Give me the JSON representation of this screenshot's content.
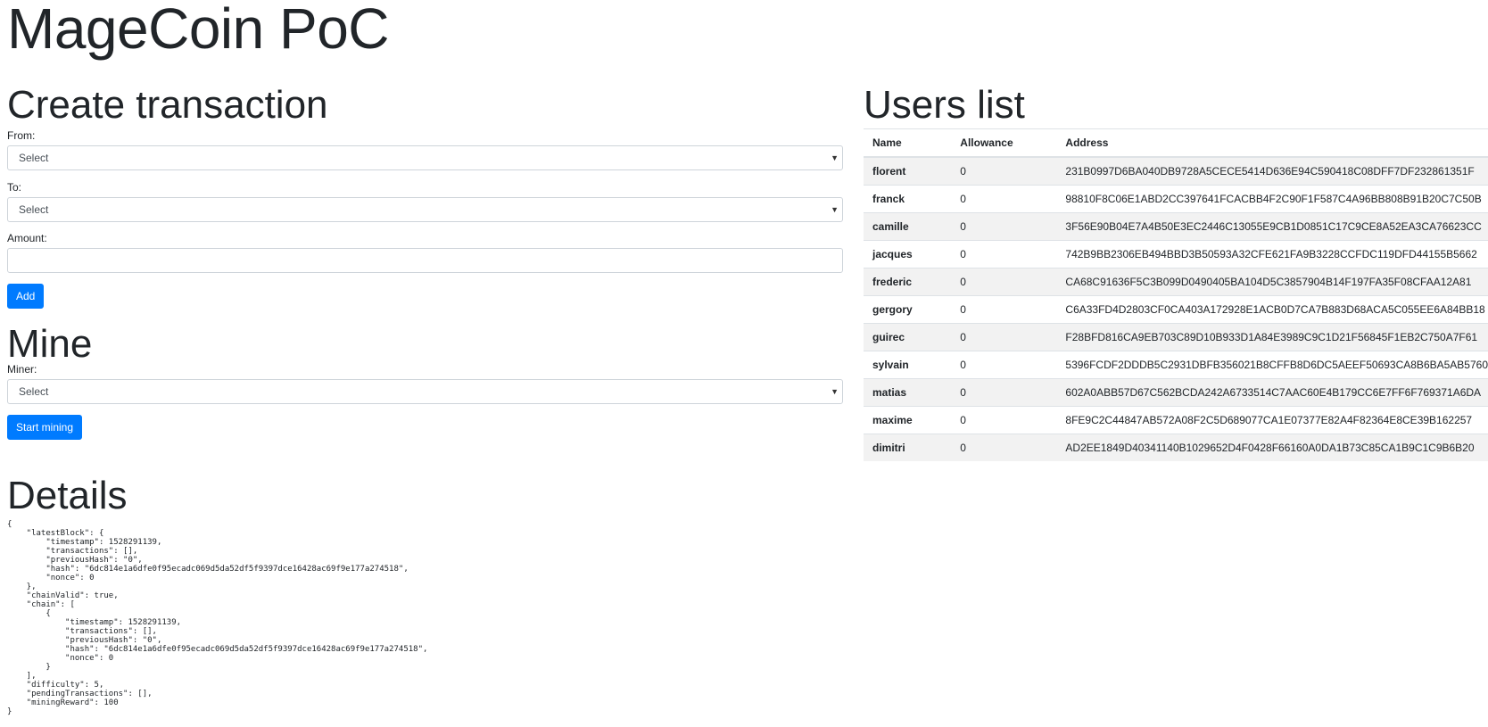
{
  "page": {
    "title": "MageCoin PoC"
  },
  "create_transaction": {
    "title": "Create transaction",
    "from_label": "From:",
    "from_value": "Select",
    "to_label": "To:",
    "to_value": "Select",
    "amount_label": "Amount:",
    "amount_value": "",
    "add_button": "Add"
  },
  "mine": {
    "title": "Mine",
    "miner_label": "Miner:",
    "miner_value": "Select",
    "start_button": "Start mining"
  },
  "users_list": {
    "title": "Users list",
    "columns": {
      "name": "Name",
      "allowance": "Allowance",
      "address": "Address"
    },
    "rows": [
      {
        "name": "florent",
        "allowance": "0",
        "address": "231B0997D6BA040DB9728A5CECE5414D636E94C590418C08DFF7DF232861351F"
      },
      {
        "name": "franck",
        "allowance": "0",
        "address": "98810F8C06E1ABD2CC397641FCACBB4F2C90F1F587C4A96BB808B91B20C7C50B"
      },
      {
        "name": "camille",
        "allowance": "0",
        "address": "3F56E90B04E7A4B50E3EC2446C13055E9CB1D0851C17C9CE8A52EA3CA76623CC"
      },
      {
        "name": "jacques",
        "allowance": "0",
        "address": "742B9BB2306EB494BBD3B50593A32CFE621FA9B3228CCFDC119DFD44155B5662"
      },
      {
        "name": "frederic",
        "allowance": "0",
        "address": "CA68C91636F5C3B099D0490405BA104D5C3857904B14F197FA35F08CFAA12A81"
      },
      {
        "name": "gergory",
        "allowance": "0",
        "address": "C6A33FD4D2803CF0CA403A172928E1ACB0D7CA7B883D68ACA5C055EE6A84BB18"
      },
      {
        "name": "guirec",
        "allowance": "0",
        "address": "F28BFD816CA9EB703C89D10B933D1A84E3989C9C1D21F56845F1EB2C750A7F61"
      },
      {
        "name": "sylvain",
        "allowance": "0",
        "address": "5396FCDF2DDDB5C2931DBFB356021B8CFFB8D6DC5AEEF50693CA8B6BA5AB5760"
      },
      {
        "name": "matias",
        "allowance": "0",
        "address": "602A0ABB57D67C562BCDA242A6733514C7AAC60E4B179CC6E7FF6F769371A6DA"
      },
      {
        "name": "maxime",
        "allowance": "0",
        "address": "8FE9C2C44847AB572A08F2C5D689077CA1E07377E82A4F82364E8CE39B162257"
      },
      {
        "name": "dimitri",
        "allowance": "0",
        "address": "AD2EE1849D40341140B1029652D4F0428F66160A0DA1B73C85CA1B9C1C9B6B20"
      }
    ]
  },
  "details": {
    "title": "Details",
    "json_text": "{\n    \"latestBlock\": {\n        \"timestamp\": 1528291139,\n        \"transactions\": [],\n        \"previousHash\": \"0\",\n        \"hash\": \"6dc814e1a6dfe0f95ecadc069d5da52df5f9397dce16428ac69f9e177a274518\",\n        \"nonce\": 0\n    },\n    \"chainValid\": true,\n    \"chain\": [\n        {\n            \"timestamp\": 1528291139,\n            \"transactions\": [],\n            \"previousHash\": \"0\",\n            \"hash\": \"6dc814e1a6dfe0f95ecadc069d5da52df5f9397dce16428ac69f9e177a274518\",\n            \"nonce\": 0\n        }\n    ],\n    \"difficulty\": 5,\n    \"pendingTransactions\": [],\n    \"miningReward\": 100\n}"
  },
  "icons": {
    "select_arrow": "chevron-down-icon"
  },
  "colors": {
    "primary": "#007bff",
    "stripe": "#f2f2f2",
    "text": "#212529"
  }
}
